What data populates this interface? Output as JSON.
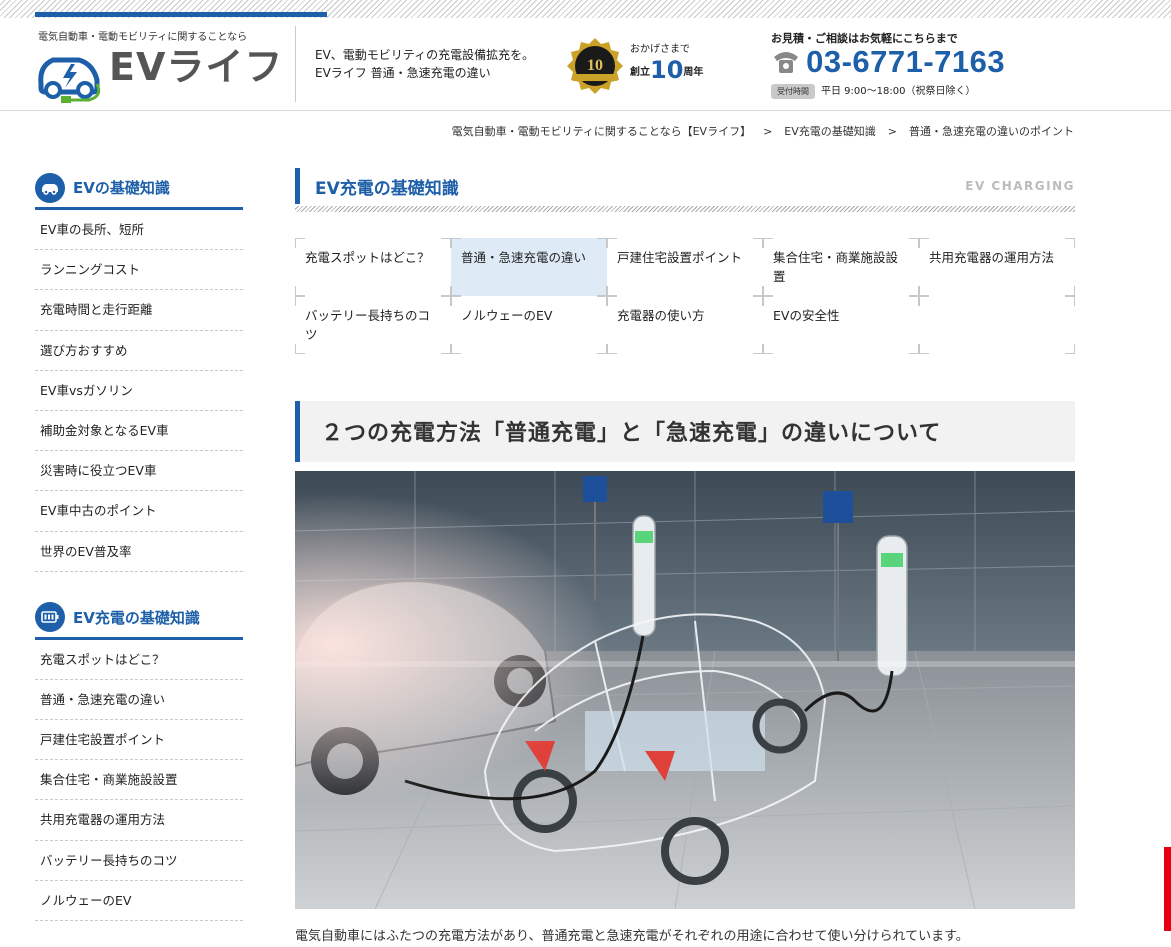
{
  "header": {
    "tagline": "電気自動車・電動モビリティに関することなら",
    "logo_text": "EVライフ",
    "description_line1": "EV、電動モビリティの充電設備拡充を。",
    "description_line2": "EVライフ 普通・急速充電の違い",
    "badge_text_top": "おかげさまで",
    "badge_text_founded": "創立",
    "badge_years": "10",
    "badge_years_suffix": "周年",
    "badge_icon": "10th-anniversary-badge",
    "contact_label": "お見積・ご相談はお気軽にこちらまで",
    "phone": "03-6771-7163",
    "hours_tag": "受付時間",
    "hours": "平日 9:00〜18:00（祝祭日除く）"
  },
  "breadcrumb": {
    "items": [
      "電気自動車・電動モビリティに関することなら【EVライフ】",
      "EV充電の基礎知識",
      "普通・急速充電の違いのポイント"
    ],
    "separator": ">"
  },
  "sidebar": {
    "sections": [
      {
        "title": "EVの基礎知識",
        "icon": "car-icon",
        "items": [
          "EV車の長所、短所",
          "ランニングコスト",
          "充電時間と走行距離",
          "選び方おすすめ",
          "EV車vsガソリン",
          "補助金対象となるEV車",
          "災害時に役立つEV車",
          "EV車中古のポイント",
          "世界のEV普及率"
        ]
      },
      {
        "title": "EV充電の基礎知識",
        "icon": "battery-icon",
        "items": [
          "充電スポットはどこ？",
          "普通・急速充電の違い",
          "戸建住宅設置ポイント",
          "集合住宅・商業施設設置",
          "共用充電器の運用方法",
          "バッテリー長持ちのコツ",
          "ノルウェーのEV"
        ]
      }
    ]
  },
  "main": {
    "section_title": "EV充電の基礎知識",
    "section_subtitle": "EV CHARGING",
    "nav": [
      {
        "label": "充電スポットはどこ？",
        "active": false
      },
      {
        "label": "普通・急速充電の違い",
        "active": true
      },
      {
        "label": "戸建住宅設置ポイント",
        "active": false
      },
      {
        "label": "集合住宅・商業施設設置",
        "active": false
      },
      {
        "label": "共用充電器の運用方法",
        "active": false
      },
      {
        "label": "バッテリー長持ちのコツ",
        "active": false
      },
      {
        "label": "ノルウェーのEV",
        "active": false
      },
      {
        "label": "充電器の使い方",
        "active": false
      },
      {
        "label": "EVの安全性",
        "active": false
      },
      {
        "label": "",
        "active": false
      }
    ],
    "article_title": "２つの充電方法「普通充電」と「急速充電」の違いについて",
    "hero_image": "ev-charging-station-illustration",
    "body_preview": "電気自動車にはふたつの充電方法があり、普通充電と急速充電がそれぞれの用途に合わせて使い分けられています。"
  },
  "colors": {
    "brand_blue": "#1d5fa8",
    "nav_active_bg": "#deebf7",
    "title_bg": "#f2f2f2",
    "red_tab": "#e60012"
  }
}
